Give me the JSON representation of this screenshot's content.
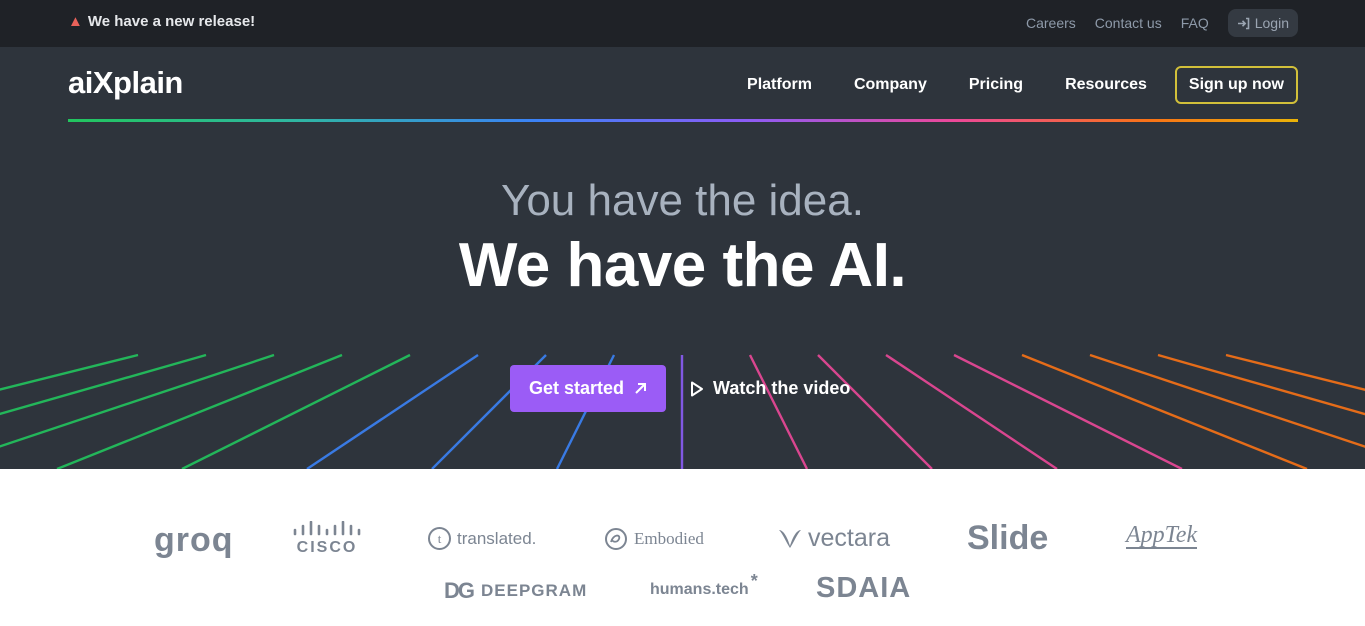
{
  "topbar": {
    "announcement": "We have a new release!",
    "links": [
      "Careers",
      "Contact us",
      "FAQ"
    ],
    "login_label": "Login"
  },
  "header": {
    "logo": "aiXplain",
    "nav": [
      "Platform",
      "Company",
      "Pricing",
      "Resources"
    ],
    "signup_label": "Sign up now"
  },
  "hero": {
    "headline_1": "You have the idea.",
    "headline_2": "We have the AI.",
    "cta_label": "Get started",
    "video_label": "Watch the video"
  },
  "partners": [
    "groq",
    "CISCO",
    "translated.",
    "Embodied",
    "vectara",
    "Slide",
    "AppTek",
    "DEEPGRAM",
    "humans.tech",
    "SDAIA"
  ],
  "colors": {
    "topbar_bg": "#1f2227",
    "hero_bg": "#2e343c",
    "accent_purple": "#9b5cf6",
    "signup_border": "#d2c03a"
  },
  "icons": [
    "party-popper-icon",
    "login-arrow-icon",
    "arrow-up-right-icon",
    "play-icon"
  ]
}
